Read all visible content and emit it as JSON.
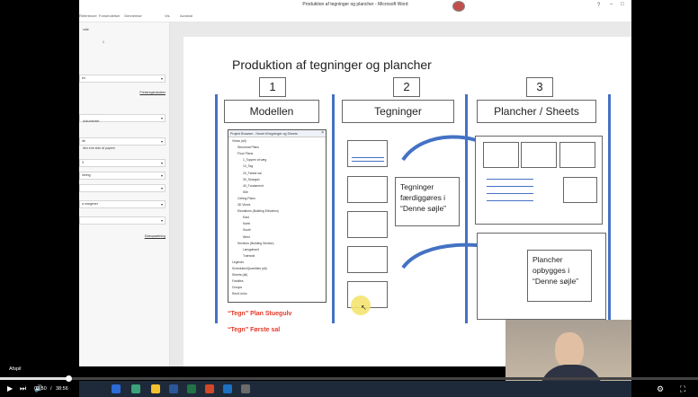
{
  "window": {
    "title": "Produktion af tegninger og plancher  -  Microsoft Word",
    "ribbon_tabs": [
      "Referencer",
      "Forsendelser",
      "Gennemse",
      "Vis",
      "Acrobat"
    ]
  },
  "left_panel": {
    "items": [
      {
        "type": "text",
        "text": "ndte"
      },
      {
        "type": "text",
        "text": "1"
      },
      {
        "type": "select",
        "text": "en"
      },
      {
        "type": "link",
        "text": "Printeregenskaber"
      },
      {
        "type": "select",
        "text": ""
      },
      {
        "type": "text",
        "text": "dokumentet"
      },
      {
        "type": "select",
        "text": "de"
      },
      {
        "type": "text",
        "text": "den ene side af papiret"
      },
      {
        "type": "select",
        "text": "3"
      },
      {
        "type": "select",
        "text": "ntning"
      },
      {
        "type": "select",
        "text": ""
      },
      {
        "type": "select",
        "text": "a margener"
      },
      {
        "type": "select",
        "text": ""
      },
      {
        "type": "link",
        "text": "Sideopsætning"
      }
    ]
  },
  "slide": {
    "title": "Produktion af tegninger og plancher",
    "columns": [
      {
        "number": "1",
        "header": "Modellen"
      },
      {
        "number": "2",
        "header": "Tegninger"
      },
      {
        "number": "3",
        "header": "Plancher / Sheets"
      }
    ],
    "note_box_1": [
      "Tegninger",
      "færdiggøres i",
      "“Denne søjle”"
    ],
    "note_box_2": [
      "Plancher",
      "opbygges i",
      "“Denne søjle”"
    ],
    "red_labels": [
      "“Tegn” Plan Stuegulv",
      "“Tegn” Første sal"
    ],
    "colors": {
      "accent_line": "#4472c4",
      "red": "#e23a2a",
      "highlight": "#f4e470"
    }
  },
  "project_browser": {
    "title": "Project Browser - Huset til tegninger og Sheets",
    "items": [
      {
        "indent": 0,
        "text": "Views (all)"
      },
      {
        "indent": 1,
        "text": "Structural Plans"
      },
      {
        "indent": 1,
        "text": "Floor Plans"
      },
      {
        "indent": 2,
        "text": "1_Toppen af væg"
      },
      {
        "indent": 2,
        "text": "10_Tag"
      },
      {
        "indent": 2,
        "text": "20_Første sal"
      },
      {
        "indent": 2,
        "text": "30_Stuegulv"
      },
      {
        "indent": 2,
        "text": "40_Fundament"
      },
      {
        "indent": 2,
        "text": "Site"
      },
      {
        "indent": 1,
        "text": "Ceiling Plans"
      },
      {
        "indent": 1,
        "text": "3D Views"
      },
      {
        "indent": 1,
        "text": "Elevations (Building Elevation)"
      },
      {
        "indent": 2,
        "text": "East"
      },
      {
        "indent": 2,
        "text": "North"
      },
      {
        "indent": 2,
        "text": "South"
      },
      {
        "indent": 2,
        "text": "West"
      },
      {
        "indent": 1,
        "text": "Sections (Building Section)"
      },
      {
        "indent": 2,
        "text": "Længdesnit"
      },
      {
        "indent": 2,
        "text": "Tværsnit"
      },
      {
        "indent": 0,
        "text": "Legends"
      },
      {
        "indent": 0,
        "text": "Schedules/Quantities (all)"
      },
      {
        "indent": 0,
        "text": "Sheets (all)"
      },
      {
        "indent": 0,
        "text": "Families"
      },
      {
        "indent": 0,
        "text": "Groups"
      },
      {
        "indent": 0,
        "text": "Revit Links"
      }
    ]
  },
  "video": {
    "label": "Afspil",
    "current_time": "03:50",
    "separator": "/",
    "duration": "38:56",
    "progress": 0.098
  }
}
